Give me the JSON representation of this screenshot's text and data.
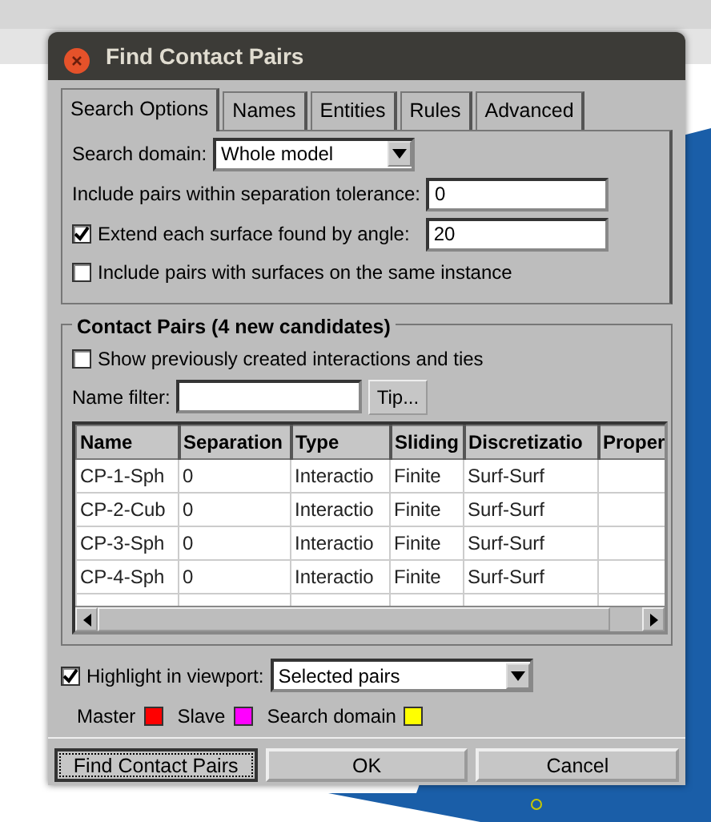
{
  "window": {
    "title": "Find Contact Pairs"
  },
  "tabs": [
    {
      "label": "Search Options",
      "selected": true
    },
    {
      "label": "Names",
      "selected": false
    },
    {
      "label": "Entities",
      "selected": false
    },
    {
      "label": "Rules",
      "selected": false
    },
    {
      "label": "Advanced",
      "selected": false
    }
  ],
  "search_domain": {
    "label": "Search domain:",
    "value": "Whole model"
  },
  "tolerance": {
    "label": "Include pairs within separation tolerance:",
    "value": "0"
  },
  "extend": {
    "label": "Extend each surface found by angle:",
    "checked": true,
    "value": "20"
  },
  "same_instance": {
    "label": "Include pairs with surfaces on the same instance",
    "checked": false
  },
  "contact_pairs": {
    "title": "Contact Pairs (4 new candidates)",
    "show_previous": {
      "label": "Show previously created interactions and ties",
      "checked": false
    },
    "name_filter": {
      "label": "Name filter:"
    },
    "tip_button": "Tip...",
    "columns": [
      "Name",
      "Separation",
      "Type",
      "Sliding",
      "Discretizatio",
      "Proper"
    ],
    "rows": [
      [
        "CP-1-Sph",
        "0",
        "Interactio",
        "Finite",
        "Surf-Surf",
        ""
      ],
      [
        "CP-2-Cub",
        "0",
        "Interactio",
        "Finite",
        "Surf-Surf",
        ""
      ],
      [
        "CP-3-Sph",
        "0",
        "Interactio",
        "Finite",
        "Surf-Surf",
        ""
      ],
      [
        "CP-4-Sph",
        "0",
        "Interactio",
        "Finite",
        "Surf-Surf",
        ""
      ]
    ]
  },
  "highlight": {
    "label": "Highlight in viewport:",
    "checked": true,
    "value": "Selected pairs"
  },
  "legend": [
    {
      "label": "Master",
      "color": "#ff0000"
    },
    {
      "label": "Slave",
      "color": "#ff00ff"
    },
    {
      "label": "Search domain",
      "color": "#ffff00"
    }
  ],
  "buttons": [
    {
      "label": "Find Contact Pairs",
      "focused": true
    },
    {
      "label": "OK",
      "focused": false
    },
    {
      "label": "Cancel",
      "focused": false
    }
  ]
}
